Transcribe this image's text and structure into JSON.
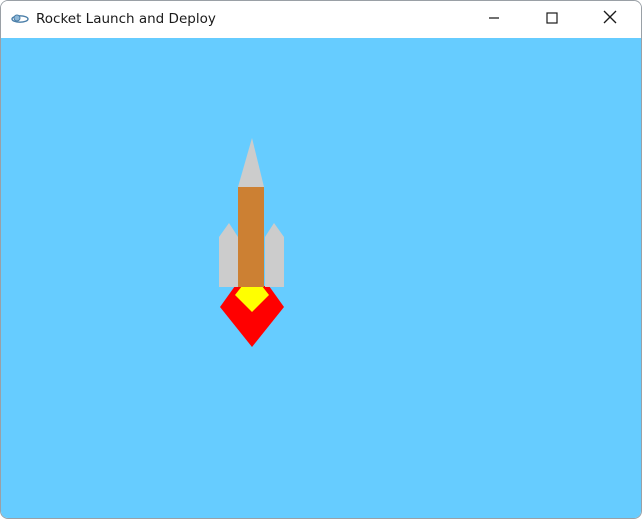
{
  "window": {
    "title": "Rocket Launch and Deploy",
    "controls": {
      "minimize_icon": "minimize-icon",
      "maximize_icon": "maximize-icon",
      "close_icon": "close-icon"
    }
  },
  "scene": {
    "sky_color": "#66CCFF",
    "rocket": {
      "nose_color": "#CCCCCC",
      "body_color": "#CC8033",
      "booster_color": "#CCCCCC",
      "flame_outer_color": "#FF0000",
      "flame_inner_color": "#FFFF00"
    }
  }
}
